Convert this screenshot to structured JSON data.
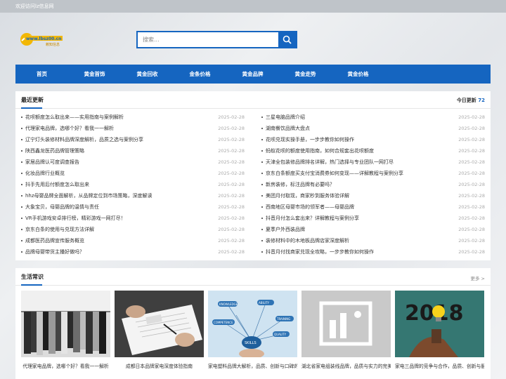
{
  "topbar": {
    "welcome": "欢迎访问lz信息网"
  },
  "logo": {
    "url_text": "www.lbsz00.cn",
    "sub_text": "赖知信息"
  },
  "search": {
    "placeholder": "搜索..."
  },
  "nav": [
    "首页",
    "黄金首饰",
    "黄金回收",
    "金条价格",
    "黄金品牌",
    "黄金走势",
    "黄金价格"
  ],
  "latest": {
    "title": "最近更新",
    "today_label": "今日更新",
    "today_count": "72",
    "left": [
      {
        "title": "花呗额度怎么取出来——实用指南与案例解析",
        "date": "2025-02-28"
      },
      {
        "title": "代理家电品牌，选哪个好？看我一一解析",
        "date": "2025-02-28"
      },
      {
        "title": "辽宁灯头装修材料品牌深度解析，品质之选与案例分享",
        "date": "2025-02-28"
      },
      {
        "title": "陕西鑫龙医药品牌管理策略",
        "date": "2025-02-28"
      },
      {
        "title": "家居品牌认可度调查报告",
        "date": "2025-02-28"
      },
      {
        "title": "化妆品牌行业概览",
        "date": "2025-02-28"
      },
      {
        "title": "抖手先用后付额度怎么取出来",
        "date": "2025-02-28"
      },
      {
        "title": "hhz母婴品牌全面解析，从品牌定位到市场策略，深度解读",
        "date": "2025-02-28"
      },
      {
        "title": "大象宝贝，母婴品牌的温情与责任",
        "date": "2025-02-28"
      },
      {
        "title": "VR手机游戏安卓排行榜，精彩游戏一网打尽！",
        "date": "2025-02-28"
      },
      {
        "title": "京东白条的使用与兑现方法详解",
        "date": "2025-02-28"
      },
      {
        "title": "成都医药品牌宣传服务概览",
        "date": "2025-02-28"
      },
      {
        "title": "品牌母婴带货主播好做吗？",
        "date": "2025-02-28"
      }
    ],
    "right": [
      {
        "title": "三星电脑品牌介绍",
        "date": "2025-02-28"
      },
      {
        "title": "湖南餐饮品牌大盘点",
        "date": "2025-02-28"
      },
      {
        "title": "花呗兑现实操手册，一步步教你如何操作",
        "date": "2025-02-28"
      },
      {
        "title": "蚂蚁花呗的额度使用指南，如何合规套出花呗额度",
        "date": "2025-02-28"
      },
      {
        "title": "天津全包装修品牌排名详解，热门选择与专业团队一网打尽",
        "date": "2025-02-28"
      },
      {
        "title": "京东白条额度买支付宝消费券如何变现——详解教程与案例分享",
        "date": "2025-02-28"
      },
      {
        "title": "新房装修，标注品牌有必要吗？",
        "date": "2025-02-28"
      },
      {
        "title": "美团月付取现，商家秒到服务体验详解",
        "date": "2025-02-28"
      },
      {
        "title": "西南地区母婴市场的领军者——母婴品牌",
        "date": "2025-02-28"
      },
      {
        "title": "抖音月付怎么套出来？详解教程与案例分享",
        "date": "2025-02-28"
      },
      {
        "title": "夏季户外西装品牌",
        "date": "2025-02-28"
      },
      {
        "title": "装修材料中的木地板品牌店家深度解析",
        "date": "2025-02-28"
      },
      {
        "title": "抖音月付找商家兑现全攻略，一步步教你如何操作",
        "date": "2025-02-28"
      }
    ]
  },
  "life": {
    "title": "生活常识",
    "more": "更多 >",
    "cards": [
      {
        "caption": "代理家电品牌，选哪个好？看我一一解析"
      },
      {
        "caption": "成都日本品牌家电深度体验指南"
      },
      {
        "caption": "家电塑料品牌大解析，品质、创新与口碑的完美结合"
      },
      {
        "caption": "湖北省家电组装线品牌，品质与实力的完美结合"
      },
      {
        "caption": "家电三品牌的竞争与合作，品质、创新与服务的较量"
      }
    ],
    "skills_words": [
      "KNOWLEDGE",
      "ABILITY",
      "TRAINING",
      "SKILLS",
      "QUALITY",
      "COMPETENCE"
    ],
    "year_text": "2018"
  },
  "colors": {
    "brand": "#1565c0",
    "accent": "#1565c0"
  }
}
